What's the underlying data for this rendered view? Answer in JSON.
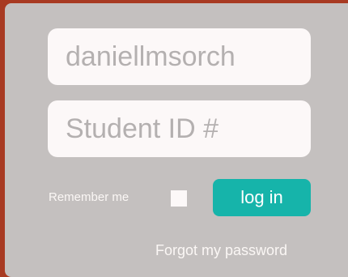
{
  "login_form": {
    "username_placeholder": "daniellmsorch",
    "student_id_placeholder": "Student ID #",
    "remember_label": "Remember me",
    "remember_checked": false,
    "login_label": "log in",
    "forgot_label": "Forgot my password"
  },
  "colors": {
    "background": "#a83a22",
    "panel": "#c4c0bf",
    "accent": "#16b4aa"
  }
}
